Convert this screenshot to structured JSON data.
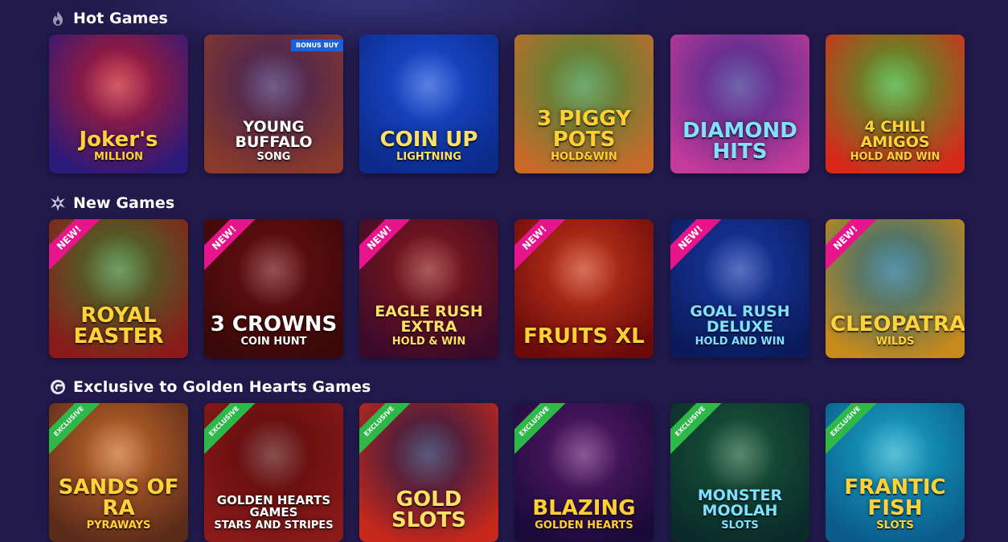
{
  "sections": {
    "hot": {
      "title": "Hot Games",
      "icon": "flame-icon",
      "games": [
        {
          "title_main": "Joker's",
          "title_sub": "MILLION",
          "colors": [
            "#c11a2a",
            "#2a1a7a"
          ]
        },
        {
          "title_main": "YOUNG BUFFALO",
          "title_sub": "SONG",
          "badge": "BONUS BUY",
          "colors": [
            "#3a1f5c",
            "#8a3a2a"
          ]
        },
        {
          "title_main": "COIN UP",
          "title_sub": "LIGHTNING",
          "colors": [
            "#1b4fd8",
            "#0b2a8a"
          ]
        },
        {
          "title_main": "3 PIGGY POTS",
          "title_sub": "HOLD&WIN",
          "colors": [
            "#3a8a3a",
            "#c86a2a"
          ]
        },
        {
          "title_main": "DIAMOND HITS",
          "title_sub": "",
          "colors": [
            "#3a2a8a",
            "#c23a9a"
          ]
        },
        {
          "title_main": "4 CHILI AMIGOS",
          "title_sub": "HOLD AND WIN",
          "colors": [
            "#3aa82a",
            "#d8281a"
          ]
        }
      ]
    },
    "new": {
      "title": "New Games",
      "icon": "sparkle-burst-icon",
      "corner_label": "NEW!",
      "games": [
        {
          "title_main": "ROYAL EASTER",
          "title_sub": "",
          "colors": [
            "#3a7a2a",
            "#8a1a1a"
          ]
        },
        {
          "title_main": "3 CROWNS",
          "title_sub": "COIN HUNT",
          "colors": [
            "#6a1010",
            "#3a0808"
          ]
        },
        {
          "title_main": "EAGLE RUSH EXTRA",
          "title_sub": "HOLD & WIN",
          "colors": [
            "#8a1a1a",
            "#3a0a2a"
          ]
        },
        {
          "title_main": "FRUITS XL",
          "title_sub": "",
          "colors": [
            "#c8381a",
            "#6a0a0a"
          ]
        },
        {
          "title_main": "GOAL RUSH DELUXE",
          "title_sub": "HOLD AND WIN",
          "colors": [
            "#1a3aa8",
            "#0a1a5a"
          ]
        },
        {
          "title_main": "CLEOPATRA",
          "title_sub": "WILDS",
          "colors": [
            "#1a6a8a",
            "#c88a1a"
          ]
        }
      ]
    },
    "exclusive": {
      "title": "Exclusive to Golden Hearts Games",
      "icon": "golden-hearts-logo-icon",
      "corner_label": "EXCLUSIVE",
      "games": [
        {
          "title_main": "SANDS OF RA",
          "title_sub": "PYRAWAYS",
          "colors": [
            "#c86a2a",
            "#5a2a1a"
          ]
        },
        {
          "title_main": "GOLDEN HEARTS GAMES",
          "title_sub": "STARS AND STRIPES",
          "colors": [
            "#5a0a0a",
            "#8a1a1a"
          ]
        },
        {
          "title_main": "GOLD SLOTS",
          "title_sub": "",
          "colors": [
            "#1a1a4a",
            "#c8281a"
          ]
        },
        {
          "title_main": "BLAZING",
          "title_sub": "GOLDEN HEARTS",
          "colors": [
            "#5a1a6a",
            "#1a0a3a"
          ]
        },
        {
          "title_main": "MONSTER MOOLAH",
          "title_sub": "SLOTS",
          "colors": [
            "#1a5a3a",
            "#0a2a2a"
          ]
        },
        {
          "title_main": "FRANTIC FISH",
          "title_sub": "SLOTS",
          "colors": [
            "#1aa8c8",
            "#0a5a8a"
          ]
        }
      ]
    }
  }
}
